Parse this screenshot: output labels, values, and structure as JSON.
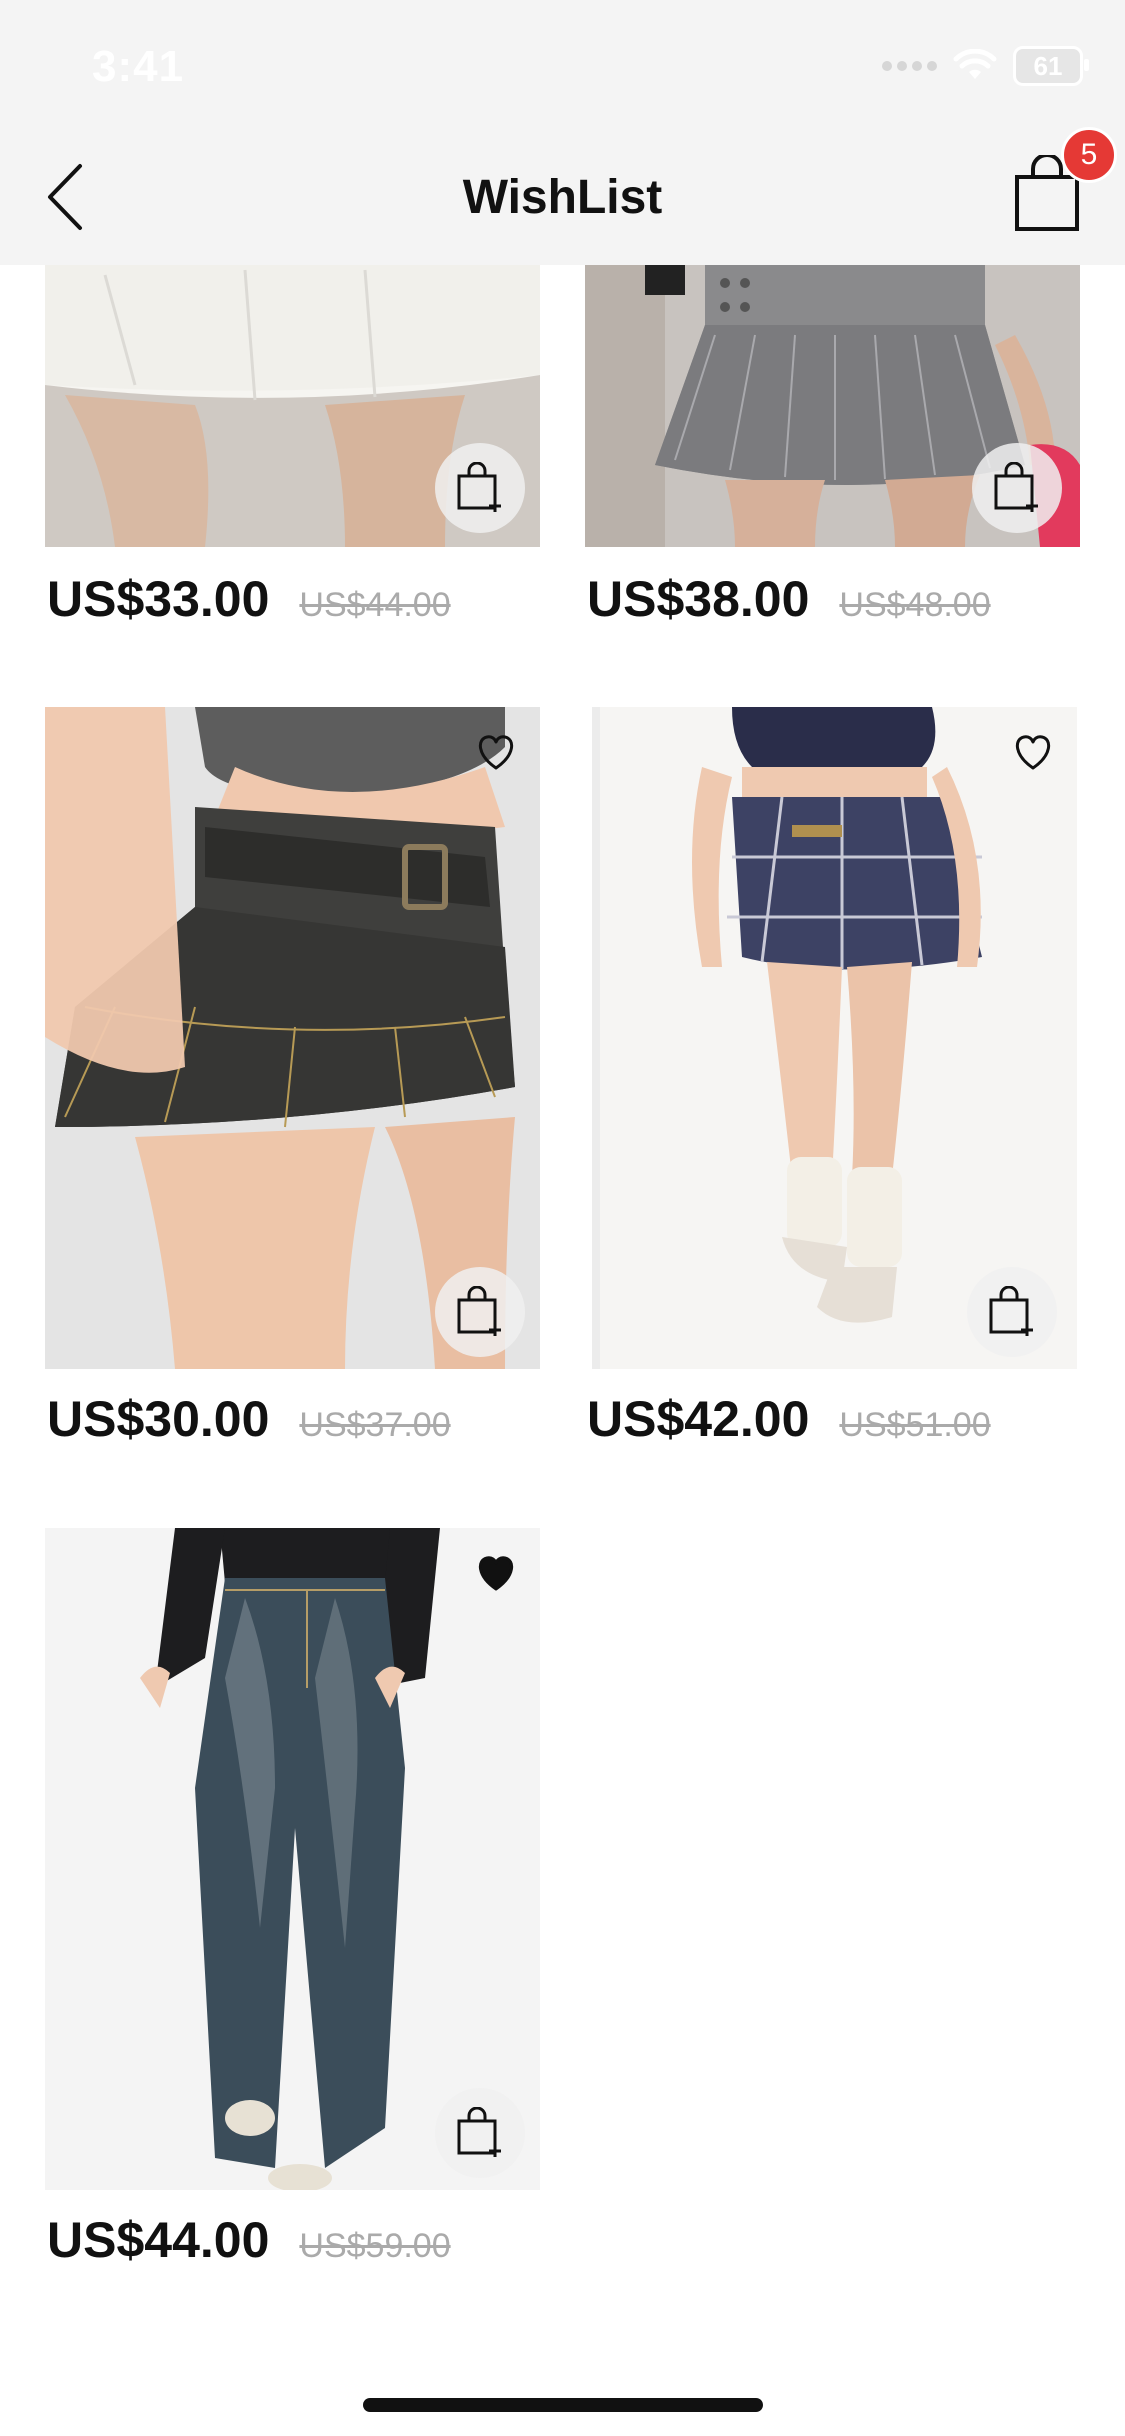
{
  "status_bar": {
    "time": "3:41",
    "battery": "61"
  },
  "header": {
    "title": "WishList",
    "cart_count": "5"
  },
  "products": [
    {
      "price": "US$33.00",
      "old_price": "US$44.00",
      "favorited": false,
      "image": "white-skirt"
    },
    {
      "price": "US$38.00",
      "old_price": "US$48.00",
      "favorited": false,
      "image": "grey-pinstripe-pleated-skirt"
    },
    {
      "price": "US$30.00",
      "old_price": "US$37.00",
      "favorited": false,
      "image": "denim-belted-skirt"
    },
    {
      "price": "US$42.00",
      "old_price": "US$51.00",
      "favorited": false,
      "image": "plaid-pleated-skirt"
    },
    {
      "price": "US$44.00",
      "old_price": "US$59.00",
      "favorited": true,
      "image": "wide-leg-jeans"
    }
  ],
  "colors": {
    "header_bg": "#f4f4f4",
    "badge": "#e53935",
    "price": "#111111",
    "old_price": "#aaaaaa"
  }
}
